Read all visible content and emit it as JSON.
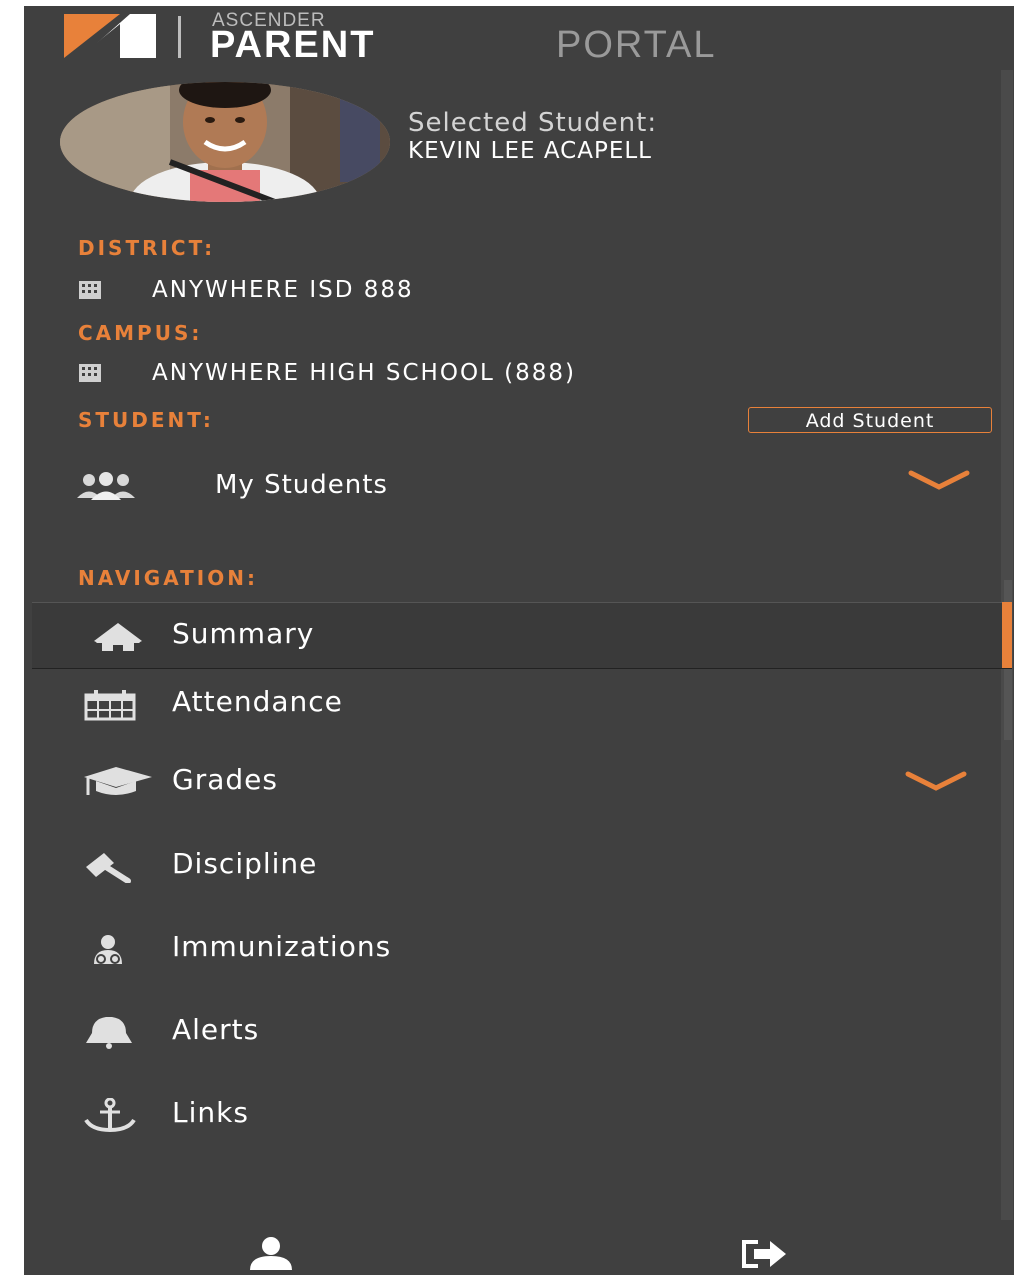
{
  "app": {
    "logo_small": "ASCENDER",
    "logo_main": "PARENT",
    "logo_accent": "PORTAL"
  },
  "student": {
    "selected_label": "Selected Student:",
    "selected_name": "KEVIN LEE ACAPELL"
  },
  "district": {
    "label": "DISTRICT:",
    "value": "ANYWHERE ISD 888"
  },
  "campus": {
    "label": "CAMPUS:",
    "value": "ANYWHERE HIGH SCHOOL (888)"
  },
  "student_section": {
    "label": "STUDENT:",
    "add_button": "Add Student",
    "dropdown_label": "My Students"
  },
  "navigation": {
    "label": "NAVIGATION:",
    "items": [
      {
        "label": "Summary",
        "icon": "home-icon",
        "active": true
      },
      {
        "label": "Attendance",
        "icon": "calendar-icon"
      },
      {
        "label": "Grades",
        "icon": "graduation-cap-icon",
        "expandable": true
      },
      {
        "label": "Discipline",
        "icon": "gavel-icon"
      },
      {
        "label": "Immunizations",
        "icon": "stethoscope-icon"
      },
      {
        "label": "Alerts",
        "icon": "bell-icon"
      },
      {
        "label": "Links",
        "icon": "anchor-icon"
      }
    ]
  },
  "footer": {
    "profile_icon": "user-icon",
    "logout_icon": "sign-out-icon"
  },
  "colors": {
    "sidebar_bg": "#404040",
    "accent": "#e8813a",
    "text": "#ffffff"
  }
}
